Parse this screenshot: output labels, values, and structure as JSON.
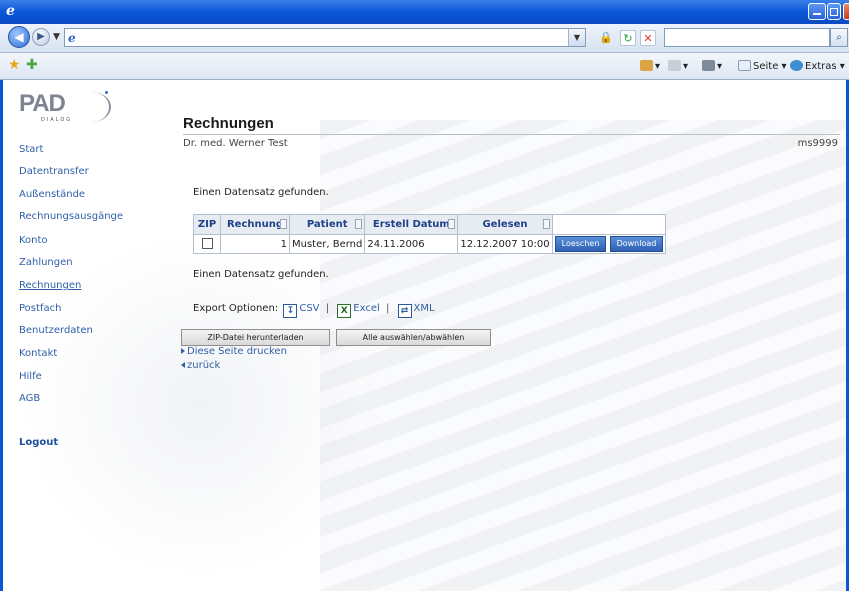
{
  "browser": {
    "address_value": "",
    "search_value": "",
    "command_bar": [
      "Seite",
      "Extras"
    ]
  },
  "site": {
    "logo_text": "PAD",
    "logo_sub": "DIALOG"
  },
  "sidebar": {
    "items": [
      {
        "label": "Start"
      },
      {
        "label": "Datentransfer"
      },
      {
        "label": "Außenstände"
      },
      {
        "label": "Rechnungsausgänge"
      },
      {
        "label": "Konto"
      },
      {
        "label": "Zahlungen"
      },
      {
        "label": "Rechnungen"
      },
      {
        "label": "Postfach"
      },
      {
        "label": "Benutzerdaten"
      },
      {
        "label": "Kontakt"
      },
      {
        "label": "Hilfe"
      },
      {
        "label": "AGB"
      }
    ],
    "logout": "Logout"
  },
  "main": {
    "title": "Rechnungen",
    "doctor": "Dr. med. Werner Test",
    "user_id": "ms9999",
    "status_top": "Einen Datensatz gefunden.",
    "status_bottom": "Einen Datensatz gefunden.",
    "table": {
      "headers": [
        "ZIP",
        "Rechnung",
        "Patient",
        "Erstell Datum",
        "Gelesen"
      ],
      "rows": [
        {
          "rechnung": "1",
          "patient": "Muster, Bernd",
          "datum": "24.11.2006",
          "gelesen": "12.12.2007 10:00",
          "delete_label": "Loeschen",
          "download_label": "Download"
        }
      ]
    },
    "export": {
      "label": "Export Optionen:",
      "csv": "CSV",
      "excel": "Excel",
      "xml": "XML",
      "separator": "|"
    },
    "zip_button": "ZIP-Datei herunterladen",
    "select_all_button": "Alle auswählen/abwählen",
    "print_link": "Diese Seite drucken",
    "back_link": "zurück"
  }
}
